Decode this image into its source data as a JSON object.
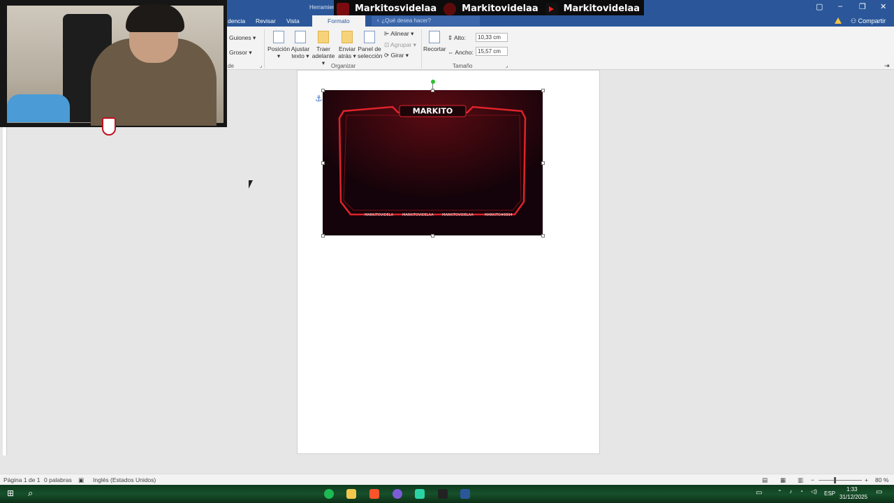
{
  "titlebar": {
    "context_label": "Herramier",
    "socials": [
      {
        "icon": "twitter-icon",
        "name": "Markitosvidelaa"
      },
      {
        "icon": "instagram-icon",
        "name": "Markitovidelaa"
      },
      {
        "icon": "youtube-icon",
        "name": "Markitovidelaa"
      }
    ],
    "window_controls": [
      "▢",
      "–",
      "❐",
      "✕"
    ]
  },
  "tabs": {
    "items": [
      "dencia",
      "Revisar",
      "Vista"
    ],
    "active": "Formato",
    "tell_me": "¿Qué desea hacer?",
    "share": "Compartir"
  },
  "ribbon": {
    "shape_format": {
      "dashes": "Guiones",
      "weight": "Grosor",
      "group_label_partial": "de"
    },
    "arrange": {
      "position": "Posición",
      "wrap_text_1": "Ajustar",
      "wrap_text_2": "texto",
      "bring_forward_1": "Traer",
      "bring_forward_2": "adelante",
      "send_backward_1": "Enviar",
      "send_backward_2": "atrás",
      "selection_pane_1": "Panel de",
      "selection_pane_2": "selección",
      "align": "Alinear",
      "group": "Agrupar",
      "rotate": "Girar",
      "label": "Organizar"
    },
    "size": {
      "crop": "Recortar",
      "height_label": "Alto:",
      "height_value": "10,33 cm",
      "width_label": "Ancho:",
      "width_value": "15,57 cm",
      "label": "Tamaño"
    }
  },
  "document": {
    "overlay_image": {
      "title": "MARKITO",
      "socials": [
        "MARKITOVIDELA",
        "MARKITOVIDELAA",
        "MARKITOVIDELAA",
        "MARKITO#8894"
      ]
    }
  },
  "statusbar": {
    "page": "Página 1 de 1",
    "words": "0 palabras",
    "language": "Inglés (Estados Unidos)",
    "zoom": "80 %"
  },
  "taskbar": {
    "language": "ESP",
    "time": "1:33",
    "date": "31/12/2025"
  },
  "colors": {
    "word_blue": "#2b579a",
    "overlay_red": "#e0232a"
  }
}
